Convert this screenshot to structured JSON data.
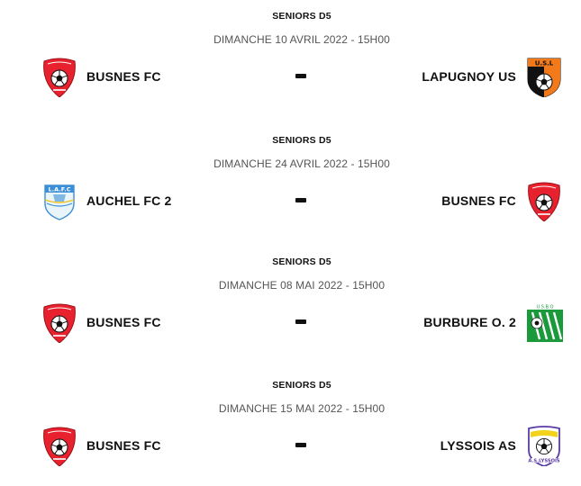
{
  "matches": [
    {
      "category": "SENIORS D5",
      "datetime": "DIMANCHE 10 AVRIL 2022 - 15H00",
      "home": {
        "name": "BUSNES FC",
        "logo_icon": "busnes-fc-crest-icon"
      },
      "separator": "-",
      "away": {
        "name": "LAPUGNOY US",
        "logo_icon": "lapugnoy-us-crest-icon"
      }
    },
    {
      "category": "SENIORS D5",
      "datetime": "DIMANCHE 24 AVRIL 2022 - 15H00",
      "home": {
        "name": "AUCHEL FC 2",
        "logo_icon": "auchel-fc-crest-icon"
      },
      "separator": "-",
      "away": {
        "name": "BUSNES FC",
        "logo_icon": "busnes-fc-crest-icon"
      }
    },
    {
      "category": "SENIORS D5",
      "datetime": "DIMANCHE 08 MAI 2022 - 15H00",
      "home": {
        "name": "BUSNES FC",
        "logo_icon": "busnes-fc-crest-icon"
      },
      "separator": "-",
      "away": {
        "name": "BURBURE O. 2",
        "logo_icon": "burbure-crest-icon"
      }
    },
    {
      "category": "SENIORS D5",
      "datetime": "DIMANCHE 15 MAI 2022 - 15H00",
      "home": {
        "name": "BUSNES FC",
        "logo_icon": "busnes-fc-crest-icon"
      },
      "separator": "-",
      "away": {
        "name": "LYSSOIS AS",
        "logo_icon": "lyssois-as-crest-icon"
      }
    }
  ],
  "colors": {
    "busnes_red": "#e8212e",
    "lapugnoy_orange": "#f27a1a",
    "burbure_green": "#1a9a3a",
    "auchel_blue": "#3a8fd6",
    "lyssois_yellow": "#f2d21a",
    "lyssois_purple": "#5a3aa8"
  }
}
